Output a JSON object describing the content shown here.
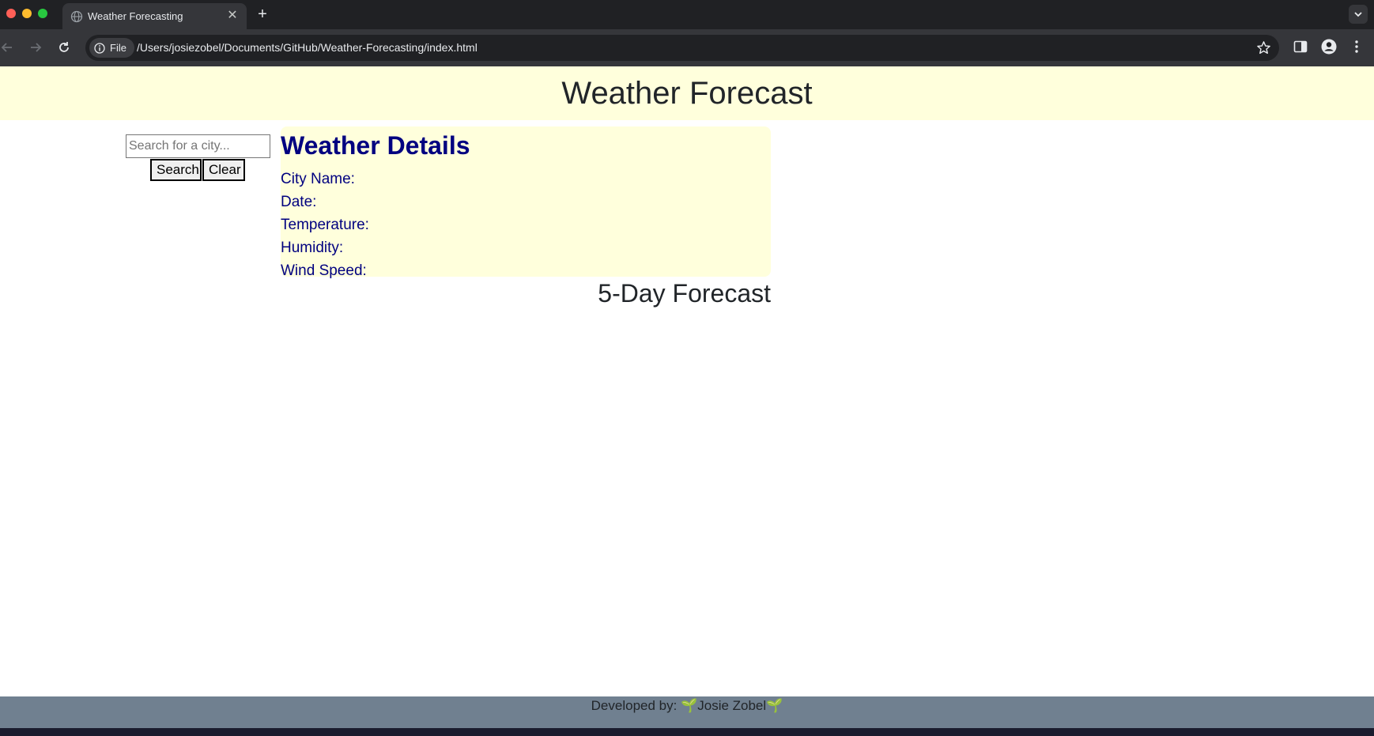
{
  "browser": {
    "tab_title": "Weather Forecasting",
    "url": "/Users/josiezobel/Documents/GitHub/Weather-Forecasting/index.html",
    "chip_label": "File"
  },
  "header": {
    "title": "Weather Forecast"
  },
  "search": {
    "placeholder": "Search for a city...",
    "search_label": "Search",
    "clear_label": "Clear"
  },
  "details": {
    "heading": "Weather Details",
    "city_label": "City Name:",
    "date_label": "Date:",
    "temperature_label": "Temperature:",
    "humidity_label": "Humidity:",
    "wind_label": "Wind Speed:"
  },
  "forecast": {
    "title": "5-Day Forecast"
  },
  "footer": {
    "prefix": "Developed by: ",
    "sprout": "🌱",
    "name": "Josie Zobel"
  },
  "colors": {
    "header_bg": "#ffffdc",
    "details_text": "#000080",
    "footer_bg": "#708090"
  }
}
